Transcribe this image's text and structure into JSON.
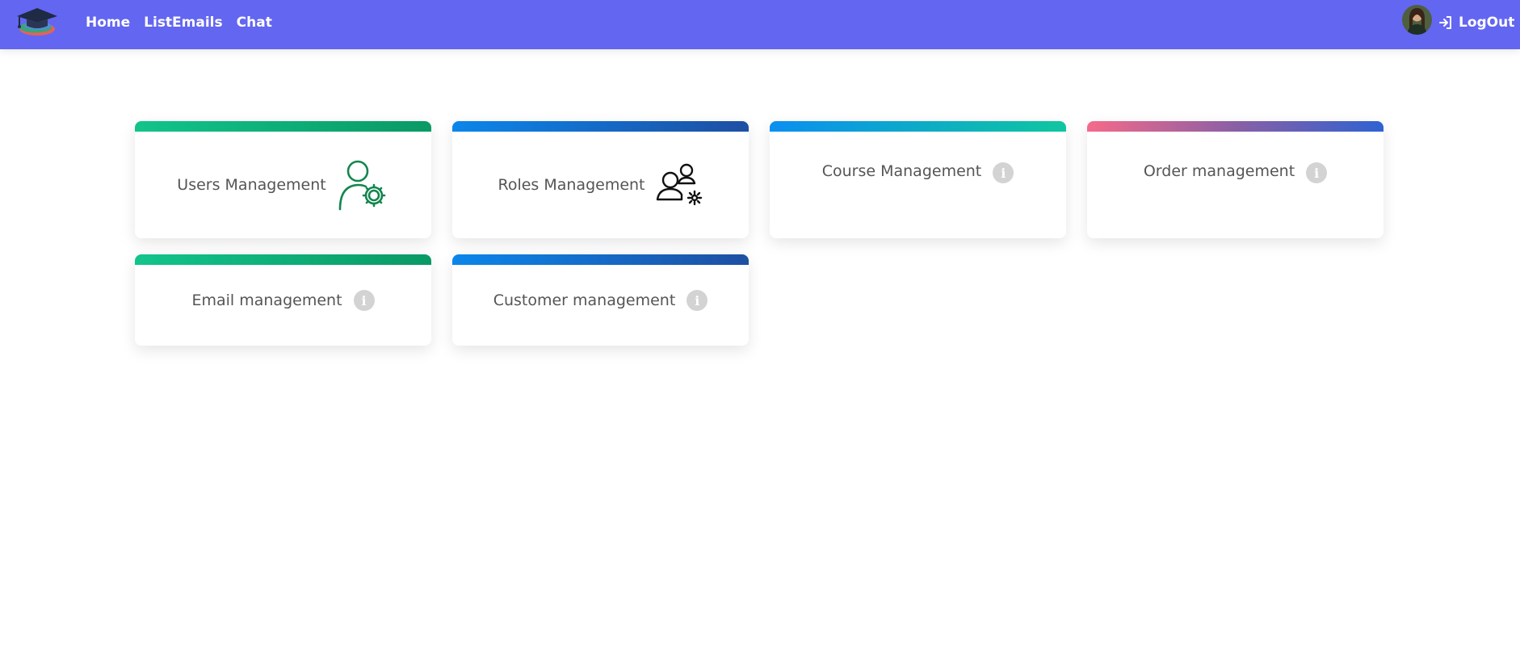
{
  "navbar": {
    "logo_icon": "graduation-cap-logo",
    "links": [
      {
        "label": "Home"
      },
      {
        "label": "ListEmails"
      },
      {
        "label": "Chat"
      }
    ],
    "avatar_icon": "user-avatar",
    "logout_icon": "sign-in-arrow-icon",
    "logout_label": "LogOut",
    "bg_color": "#6366f1"
  },
  "cards": [
    {
      "title": "Users Management",
      "icon": "user-gear-icon",
      "bar": "green-gradient"
    },
    {
      "title": "Roles Management",
      "icon": "users-gear-icon",
      "bar": "blue-gradient"
    },
    {
      "title": "Course Management",
      "icon": "info-icon",
      "bar": "blue-teal-gradient"
    },
    {
      "title": "Order management",
      "icon": "info-icon",
      "bar": "pink-purple-blue-gradient"
    },
    {
      "title": "Email management",
      "icon": "info-icon",
      "bar": "green-gradient"
    },
    {
      "title": "Customer management",
      "icon": "info-icon",
      "bar": "blue-gradient"
    }
  ],
  "info_glyph": "i"
}
